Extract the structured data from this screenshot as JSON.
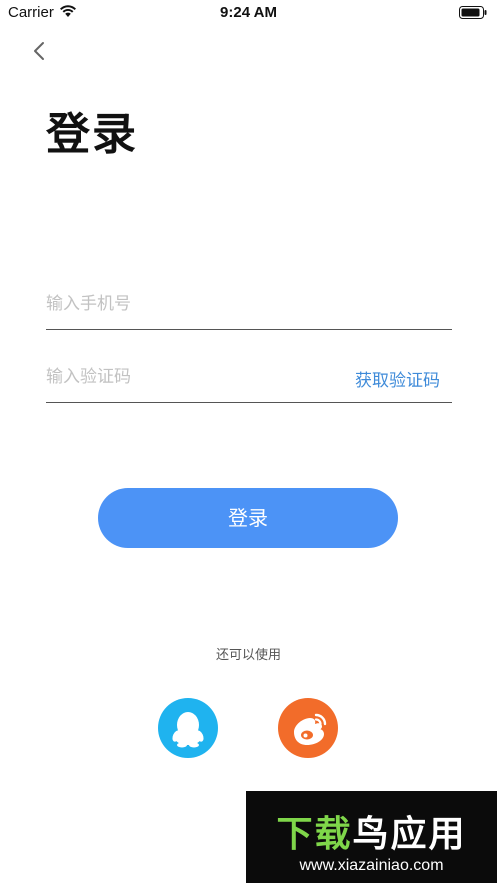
{
  "status_bar": {
    "carrier": "Carrier",
    "time": "9:24 AM"
  },
  "page": {
    "title": "登录"
  },
  "form": {
    "phone_placeholder": "输入手机号",
    "code_placeholder": "输入验证码",
    "get_code_label": "获取验证码",
    "login_label": "登录"
  },
  "social": {
    "label": "还可以使用",
    "icons": [
      "qq-icon",
      "weibo-icon"
    ]
  },
  "watermark": {
    "title_part1": "下载",
    "title_part2": "鸟应用",
    "url": "www.xiazainiao.com"
  },
  "colors": {
    "accent": "#4c93f6",
    "link": "#3f8bd9",
    "qq": "#1fb3ef",
    "weibo": "#f26c2a"
  }
}
